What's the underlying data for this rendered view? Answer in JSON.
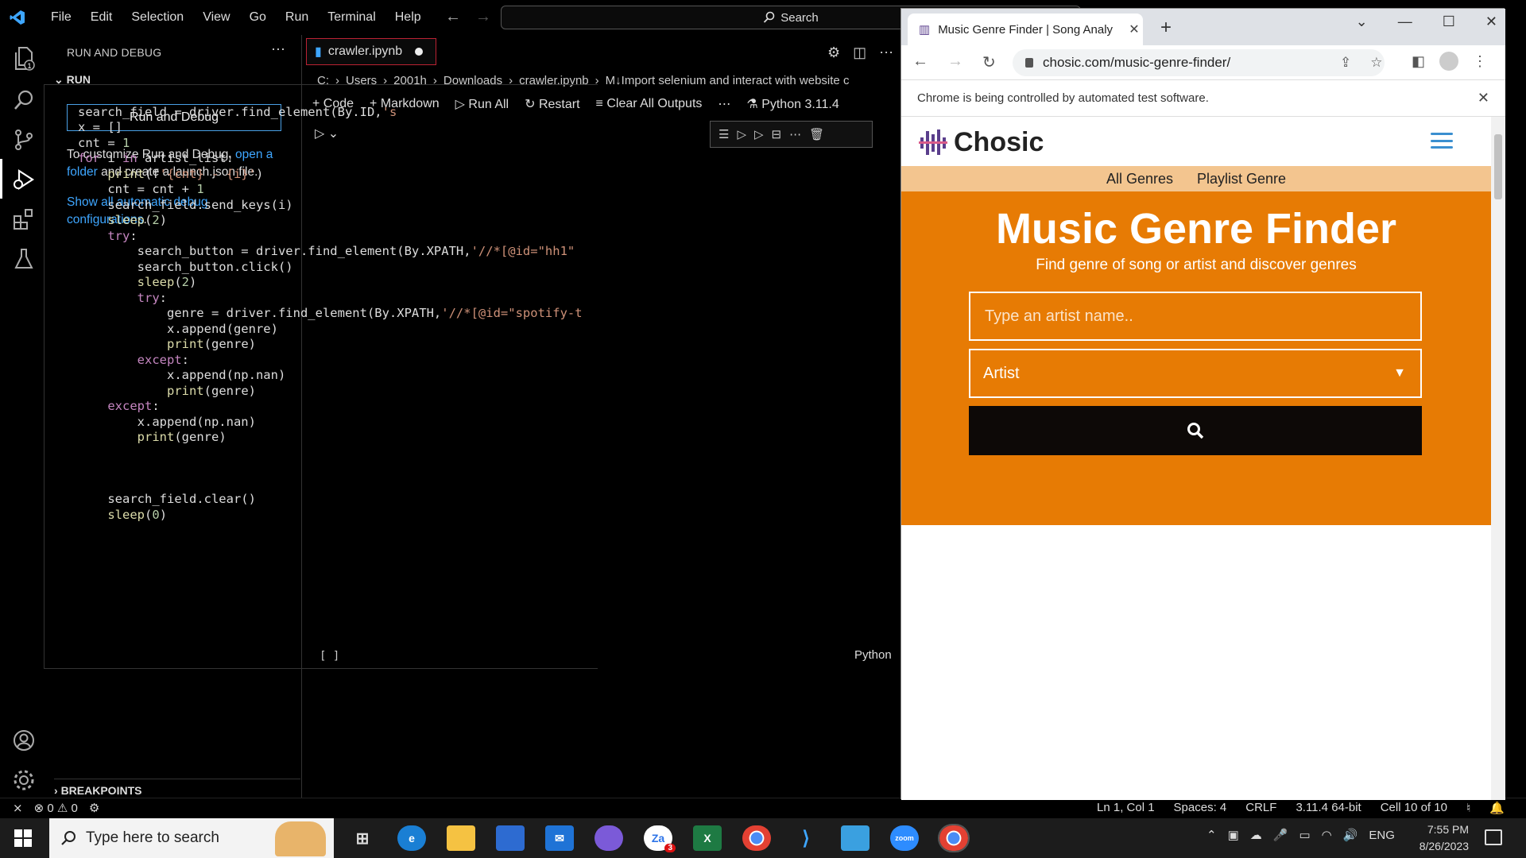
{
  "vscode": {
    "menu": [
      "File",
      "Edit",
      "Selection",
      "View",
      "Go",
      "Run",
      "Terminal",
      "Help"
    ],
    "search_label": "Search",
    "sidebar": {
      "title": "RUN AND DEBUG",
      "section": "RUN",
      "run_button": "Run and Debug",
      "customize_prefix": "To customize Run and Debug,",
      "open_folder_link": "open a folder",
      "customize_suffix": "and create a launch.json file.",
      "show_configs_link": "Show all automatic debug configurations",
      "show_configs_suffix": ".",
      "breakpoints": "BREAKPOINTS"
    },
    "explorer_badge": "1",
    "tab": {
      "label": "crawler.ipynb"
    },
    "breadcrumb": [
      "C:",
      "Users",
      "2001h",
      "Downloads",
      "crawler.ipynb",
      "M↓Import selenium and interact with website c"
    ],
    "notebook_toolbar": {
      "code": "Code",
      "markdown": "Markdown",
      "run_all": "Run All",
      "restart": "Restart",
      "clear": "Clear All Outputs",
      "more": "⋯",
      "kernel": "Python 3.11.4"
    },
    "cell": {
      "lines": [
        "search_field = driver.find_element(By.ID,'s",
        "x = []",
        "cnt = 1",
        "for i in artist_list:",
        "    print(f'{cnt} - {i}')",
        "    cnt = cnt + 1",
        "    search_field.send_keys(i)",
        "    sleep(2)",
        "    try:",
        "        search_button = driver.find_element(By.XPATH,'//*[@id=\"hh1\"",
        "        search_button.click()",
        "        sleep(2)",
        "        try:",
        "            genre = driver.find_element(By.XPATH,'//*[@id=\"spotify-t",
        "            x.append(genre)",
        "            print(genre)",
        "        except:",
        "            x.append(np.nan)",
        "            print(genre)",
        "    except:",
        "        x.append(np.nan)",
        "        print(genre)",
        "",
        "",
        "",
        "    search_field.clear()",
        "    sleep(0)"
      ],
      "exec_index": "[ ]",
      "language": "Python"
    },
    "status": {
      "errors": "0",
      "warnings": "0",
      "position": "Ln 1, Col 1",
      "spaces": "Spaces: 4",
      "eol": "CRLF",
      "interpreter": "3.11.4 64-bit",
      "cell": "Cell 10 of 10"
    }
  },
  "chrome": {
    "tab_title": "Music Genre Finder | Song Analy",
    "url": "chosic.com/music-genre-finder/",
    "infobar": "Chrome is being controlled by automated test software.",
    "site": {
      "logo": "Chosic",
      "nav": [
        "All Genres",
        "Playlist Genre"
      ],
      "heading": "Music Genre Finder",
      "subheading": "Find genre of song or artist and discover genres",
      "input_placeholder": "Type an artist name..",
      "select_value": "Artist"
    }
  },
  "taskbar": {
    "search_placeholder": "Type here to search",
    "language": "ENG",
    "time": "7:55 PM",
    "date": "8/26/2023",
    "zoom_badge": "3"
  }
}
